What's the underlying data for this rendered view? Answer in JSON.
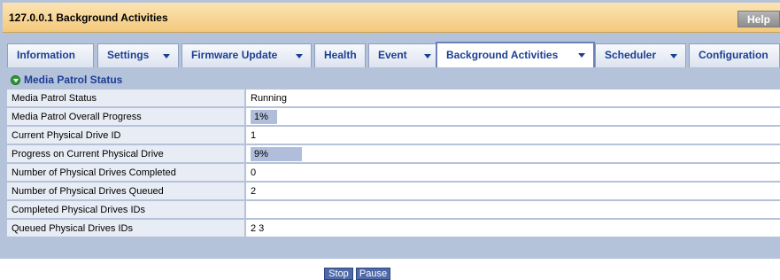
{
  "window": {
    "title": "127.0.0.1 Background Activities",
    "help_label": "Help"
  },
  "tabs": [
    {
      "label": "Information",
      "has_menu": false
    },
    {
      "label": "Settings",
      "has_menu": true
    },
    {
      "label": "Firmware Update",
      "has_menu": true
    },
    {
      "label": "Health",
      "has_menu": false
    },
    {
      "label": "Event",
      "has_menu": true
    },
    {
      "label": "Background Activities",
      "has_menu": true,
      "active": true
    },
    {
      "label": "Scheduler",
      "has_menu": true
    },
    {
      "label": "Configuration",
      "has_menu": false
    }
  ],
  "section": {
    "title": "Media Patrol Status",
    "icon": "collapse-arrow-icon"
  },
  "rows": [
    {
      "label": "Media Patrol Status",
      "value": "Running"
    },
    {
      "label": "Media Patrol Overall Progress",
      "value": "1%",
      "progress": 1
    },
    {
      "label": "Current Physical Drive ID",
      "value": "1"
    },
    {
      "label": "Progress on Current Physical Drive",
      "value": "9%",
      "progress": 9
    },
    {
      "label": "Number of Physical Drives Completed",
      "value": "0"
    },
    {
      "label": "Number of Physical Drives Queued",
      "value": "2"
    },
    {
      "label": "Completed Physical Drives IDs",
      "value": ""
    },
    {
      "label": "Queued Physical Drives IDs",
      "value": "2 3"
    }
  ],
  "buttons": {
    "stop_label": "Stop",
    "pause_label": "Pause"
  },
  "colors": {
    "title_bg": "#f4c97c",
    "frame": "#b4c2da",
    "tab_text": "#1c3f94",
    "button": "#4e6aa8",
    "progress": "#b0bedc"
  }
}
